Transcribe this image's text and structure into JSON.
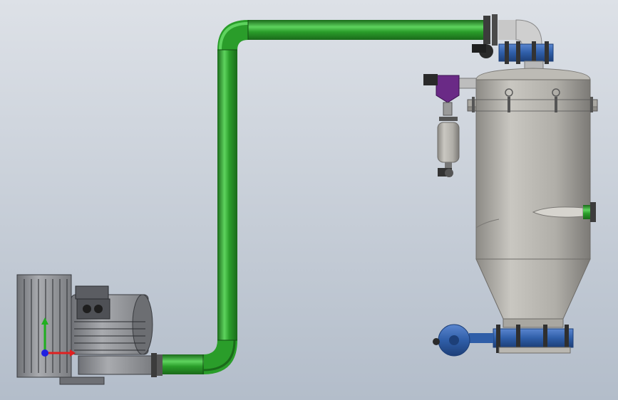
{
  "viewport": {
    "background_top": "#dde1e7",
    "background_bottom": "#b3bdca"
  },
  "components": {
    "conveying_pipe": {
      "color": "#2a9d2a",
      "highlight": "#5ed35e",
      "shade": "#1a6a1a"
    },
    "blower": {
      "body_color": "#8d8f93",
      "dark_color": "#3a3c40"
    },
    "receiver_hopper": {
      "body_color": "#b0aea8",
      "shade": "#8c8a85"
    },
    "rotary_valve_body": {
      "color": "#2f5ea8"
    },
    "filter_pulse_valve": {
      "color": "#6a2a86"
    }
  },
  "triad": {
    "x_color": "#e02020",
    "y_color": "#20b020",
    "z_color": "#2020e0"
  }
}
